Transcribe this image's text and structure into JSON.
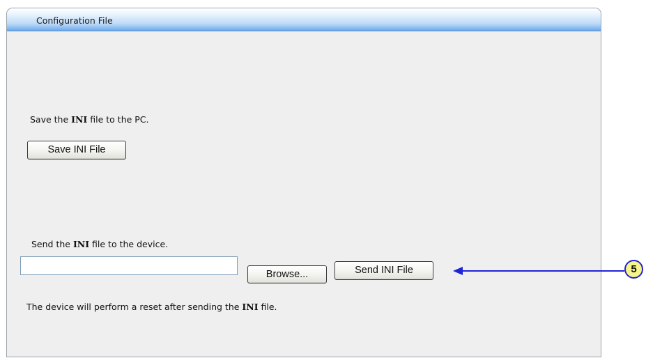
{
  "panel": {
    "title": "Configuration File"
  },
  "save_section": {
    "text_before": "Save the ",
    "text_bold": "INI",
    "text_after": " file to the PC.",
    "button_label": "Save INI File"
  },
  "send_section": {
    "text_before": "Send the ",
    "text_bold": "INI",
    "text_after": " file to the device.",
    "file_input_value": "",
    "browse_label": "Browse...",
    "send_label": "Send INI File",
    "note_before": "The device will perform a reset after sending the ",
    "note_bold": "INI",
    "note_after": " file."
  },
  "callout": {
    "label": "5",
    "color": "#1f24d6",
    "fill": "#f7f48a"
  }
}
